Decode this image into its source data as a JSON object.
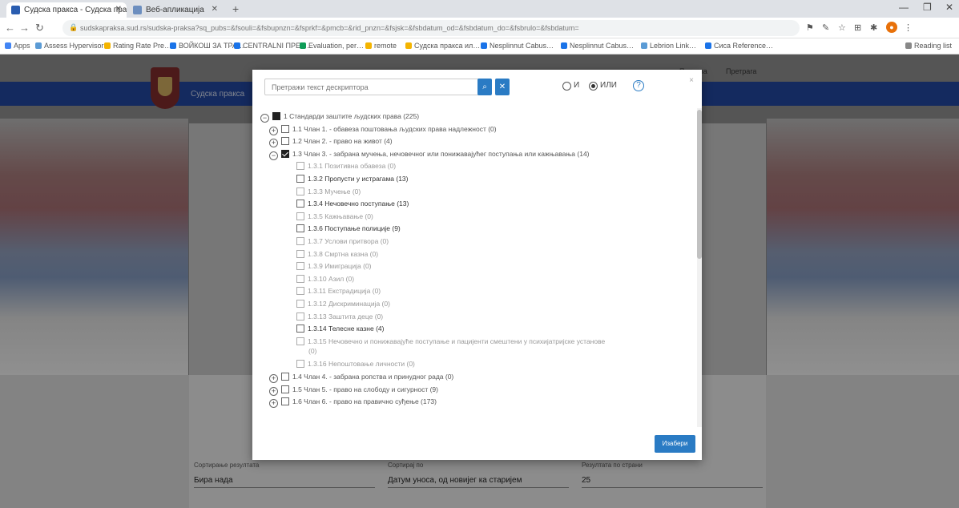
{
  "browser": {
    "tabs": [
      {
        "title": "Судска пракса - Судска пракса",
        "active": true
      },
      {
        "title": "Веб-апликација",
        "active": false
      }
    ],
    "url": "sudskapraksa.sud.rs/sudska-praksa?sq_pubs=&fsouli=&fsbupnzn=&fsprkf=&pmcb=&rid_pnzn=&fsjsk=&fsbdatum_od=&fsbdatum_do=&fsbrulo=&fsbdatum=",
    "bookmarks": [
      "Apps",
      "Assess Hypervisor",
      "Rating Rate Pre…",
      "ВОЙКОШ ЗА ТРА…",
      "CENTRALNI ПРЕГ…",
      "Evaluation, per…",
      "remote",
      "Судска пракса ил…",
      "Nesplinnut Cabus…",
      "Nesplinnut Cabus…",
      "Lebrion Link…",
      "Сиса Reference…",
      "Reading list"
    ]
  },
  "site": {
    "topnav": [
      "Почетна",
      "Претрага"
    ],
    "banner_title": "Судска пракса",
    "bottom_fields": [
      {
        "label": "Сортирање резултата",
        "value": "Бира нада"
      },
      {
        "label": "Сортирај по",
        "value": "Датум уноса, од новијег ка старијем"
      },
      {
        "label": "Резултата по страни",
        "value": "25"
      }
    ]
  },
  "modal": {
    "search_placeholder": "Претражи текст дескриптора",
    "search_icon": "search-icon",
    "clear_icon": "clear-icon",
    "radio_and": "И",
    "radio_or": "ИЛИ",
    "selected_mode": "ИЛИ",
    "help_icon": "help-icon",
    "close_label": "×",
    "choose_button": "Изабери",
    "tree": [
      {
        "text": "1 Стандарди заштите људских права (225)",
        "level": 0,
        "state": "full",
        "toggle": "−"
      },
      {
        "text": "1.1 Члан 1. - обавеза поштовања људских права надлежност (0)",
        "level": 1,
        "state": "empty",
        "toggle": "+"
      },
      {
        "text": "1.2 Члан 2. - право на живот (4)",
        "level": 1,
        "state": "empty",
        "toggle": "+"
      },
      {
        "text": "1.3 Члан 3. - забрана мучења, нечовечног или понижавајућег поступања или кажњавања (14)",
        "level": 1,
        "state": "checked",
        "toggle": "−"
      },
      {
        "text": "1.3.1 Позитивна обавеза (0)",
        "level": 2,
        "state": "dim"
      },
      {
        "text": "1.3.2 Пропусти у истрагама (13)",
        "level": 2,
        "state": "normal"
      },
      {
        "text": "1.3.3 Мучење (0)",
        "level": 2,
        "state": "dim"
      },
      {
        "text": "1.3.4 Нечовечно поступање (13)",
        "level": 2,
        "state": "normal"
      },
      {
        "text": "1.3.5 Кажњавање (0)",
        "level": 2,
        "state": "dim"
      },
      {
        "text": "1.3.6 Поступање полиције (9)",
        "level": 2,
        "state": "normal"
      },
      {
        "text": "1.3.7 Услови притвора (0)",
        "level": 2,
        "state": "dim"
      },
      {
        "text": "1.3.8 Смртна казна (0)",
        "level": 2,
        "state": "dim"
      },
      {
        "text": "1.3.9 Имиграција (0)",
        "level": 2,
        "state": "dim"
      },
      {
        "text": "1.3.10 Азил (0)",
        "level": 2,
        "state": "dim"
      },
      {
        "text": "1.3.11 Екстрадиција (0)",
        "level": 2,
        "state": "dim"
      },
      {
        "text": "1.3.12 Дискриминација (0)",
        "level": 2,
        "state": "dim"
      },
      {
        "text": "1.3.13 Заштита деце (0)",
        "level": 2,
        "state": "dim"
      },
      {
        "text": "1.3.14 Телесне казне (4)",
        "level": 2,
        "state": "normal"
      },
      {
        "text": "1.3.15 Нечовечно и понижавајуће поступање и пацијенти смештени у психијатријске установе",
        "level": 2,
        "state": "dim",
        "cont": "(0)"
      },
      {
        "text": "1.3.16 Непоштовање личности (0)",
        "level": 2,
        "state": "dim"
      },
      {
        "text": "1.4 Члан 4. - забрана ропства и принудног рада (0)",
        "level": 1,
        "state": "empty",
        "toggle": "+"
      },
      {
        "text": "1.5 Члан 5. - право на слободу и сигурност (9)",
        "level": 1,
        "state": "empty",
        "toggle": "+"
      },
      {
        "text": "1.6 Члан 6. - право на правично суђење (173)",
        "level": 1,
        "state": "empty",
        "toggle": "+"
      }
    ]
  },
  "colors": {
    "accent": "#2a7bc4",
    "banner": "#21459a"
  }
}
